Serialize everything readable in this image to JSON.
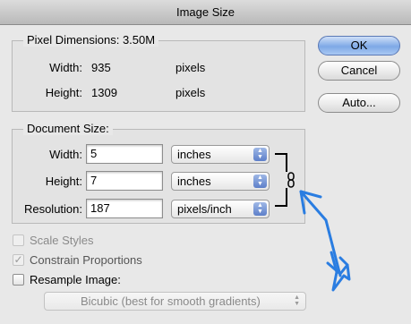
{
  "window": {
    "title": "Image Size"
  },
  "pixel_dimensions": {
    "title": "Pixel Dimensions:",
    "size": "3.50M",
    "width_label": "Width:",
    "width_value": "935",
    "width_unit": "pixels",
    "height_label": "Height:",
    "height_value": "1309",
    "height_unit": "pixels"
  },
  "document_size": {
    "title": "Document Size:",
    "width_label": "Width:",
    "width_value": "5",
    "width_unit": "inches",
    "height_label": "Height:",
    "height_value": "7",
    "height_unit": "inches",
    "resolution_label": "Resolution:",
    "resolution_value": "187",
    "resolution_unit": "pixels/inch"
  },
  "buttons": {
    "ok": "OK",
    "cancel": "Cancel",
    "auto": "Auto..."
  },
  "options": {
    "scale_styles": {
      "label": "Scale Styles",
      "checked": false,
      "enabled": false
    },
    "constrain_proportions": {
      "label": "Constrain Proportions",
      "checked": true,
      "enabled": false
    },
    "resample_image": {
      "label": "Resample Image:",
      "checked": false,
      "enabled": true
    },
    "resample_method": "Bicubic (best for smooth gradients)"
  },
  "icons": {
    "link": "chain-link-icon",
    "annotation": "hand-drawn-arrow-icon",
    "select": "updown-arrows-icon"
  },
  "colors": {
    "annotation_arrow": "#2a7de1",
    "default_button": "#7ea9e6"
  }
}
